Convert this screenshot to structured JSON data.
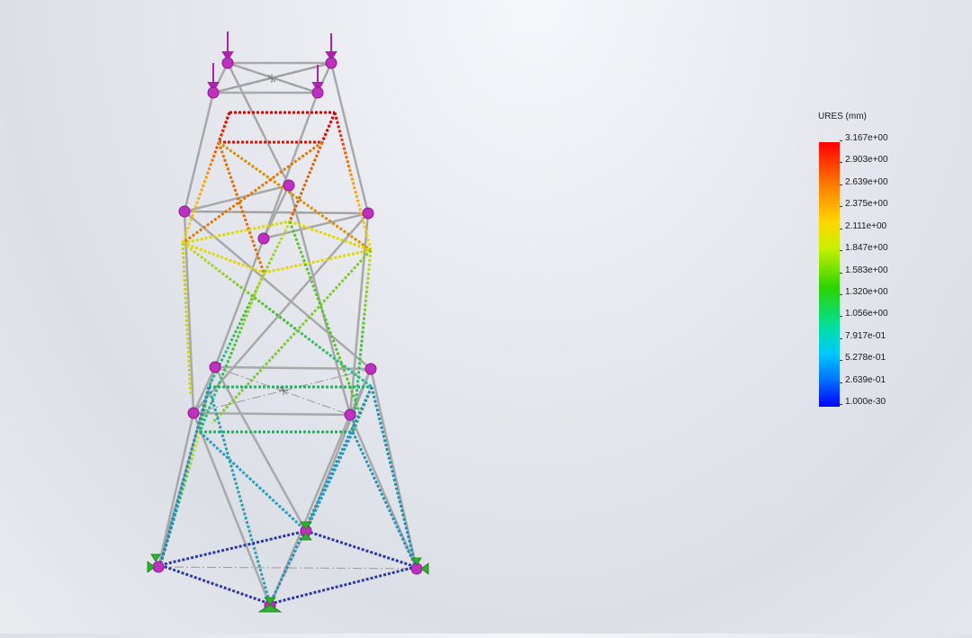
{
  "legend": {
    "title": "URES (mm)",
    "ticks": [
      "3.167e+00",
      "2.903e+00",
      "2.639e+00",
      "2.375e+00",
      "2.111e+00",
      "1.847e+00",
      "1.583e+00",
      "1.320e+00",
      "1.056e+00",
      "7.917e-01",
      "5.278e-01",
      "2.639e-01",
      "1.000e-30"
    ]
  },
  "colors": {
    "max": "#ff0000",
    "high": "#ff8a00",
    "mid_high": "#e8e000",
    "mid": "#30c020",
    "low": "#10b8c8",
    "min": "#1a2aa0",
    "beam_undeformed": "#a5a5a5",
    "node_marker": "#c030c0",
    "fixture_marker": "#30b030"
  }
}
